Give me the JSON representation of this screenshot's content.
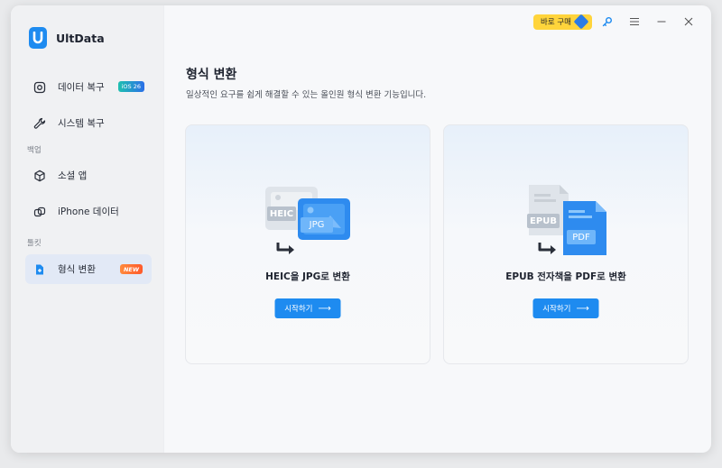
{
  "app": {
    "name": "UltData"
  },
  "topbar": {
    "buy_label": "바로 구매"
  },
  "sidebar": {
    "items": [
      {
        "label": "데이터 복구",
        "badge": "iOS 26"
      },
      {
        "label": "시스템 복구"
      },
      {
        "section": "백업"
      },
      {
        "label": "소셜 앱"
      },
      {
        "label": "iPhone 데이터"
      },
      {
        "section": "툴킷"
      },
      {
        "label": "형식 변환",
        "badge": "NEW"
      }
    ]
  },
  "main": {
    "title": "형식 변환",
    "subtitle": "일상적인 요구를 쉽게 해결할 수 있는 올인원 형식 변환 기능입니다.",
    "cards": [
      {
        "title": "HEIC을 JPG로 변환",
        "button": "시작하기",
        "from": "HEIC",
        "to": "JPG"
      },
      {
        "title": "EPUB 전자책을 PDF로 변환",
        "button": "시작하기",
        "from": "EPUB",
        "to": "PDF"
      }
    ]
  },
  "colors": {
    "accent": "#1e8bf0",
    "buy": "#ffd43b",
    "active_nav": "#e2e9f6"
  }
}
